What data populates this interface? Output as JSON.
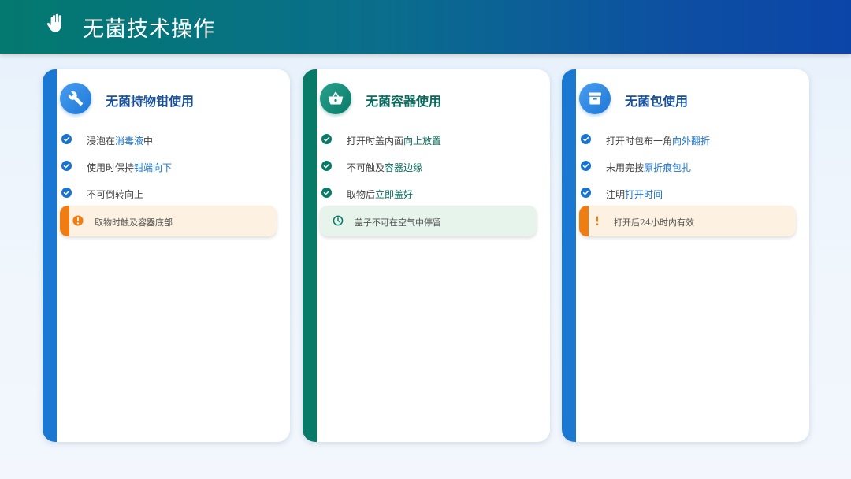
{
  "header": {
    "title": "无菌技术操作",
    "icon": "hand-icon"
  },
  "colors": {
    "blue": "#1a78d2",
    "green": "#087a68",
    "orange": "#f07d12"
  },
  "cards": [
    {
      "title": "无菌持物钳使用",
      "icon": "wrench-icon",
      "items": [
        {
          "pre": "浸泡在",
          "hl": "消毒液",
          "post": "中"
        },
        {
          "pre": "使用时保持",
          "hl": "钳端向下",
          "post": ""
        },
        {
          "pre": "不可倒转向上",
          "hl": "",
          "post": ""
        }
      ],
      "note": {
        "icon": "info-icon",
        "text": "取物时触及容器底部"
      }
    },
    {
      "title": "无菌容器使用",
      "icon": "basket-icon",
      "items": [
        {
          "pre": "打开时盖内面",
          "hl": "向上放置",
          "post": ""
        },
        {
          "pre": "不可触及",
          "hl": "容器边缘",
          "post": ""
        },
        {
          "pre": "取物后",
          "hl": "立即盖好",
          "post": ""
        }
      ],
      "note": {
        "icon": "clock-icon",
        "text": "盖子不可在空气中停留"
      }
    },
    {
      "title": "无菌包使用",
      "icon": "archive-box-icon",
      "items": [
        {
          "pre": "打开时包布一角",
          "hl": "向外翻折",
          "post": ""
        },
        {
          "pre": "未用完按",
          "hl": "原折痕包扎",
          "post": ""
        },
        {
          "pre": "注明",
          "hl": "打开时间",
          "post": ""
        }
      ],
      "note": {
        "icon": "exclamation-icon",
        "text": "打开后24小时内有效"
      }
    }
  ]
}
